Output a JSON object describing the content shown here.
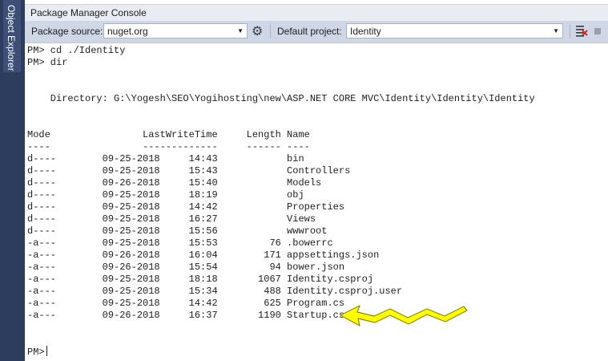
{
  "side": {
    "tab_label": "Object Explorer"
  },
  "window": {
    "title": "Package Manager Console"
  },
  "toolbar": {
    "package_source_label": "Package source:",
    "package_source_value": "nuget.org",
    "default_project_label": "Default project:",
    "default_project_value": "Identity"
  },
  "console": {
    "cmd1": "PM> cd ./Identity",
    "cmd2": "PM> dir",
    "directory_line": "    Directory: G:\\Yogesh\\SEO\\Yogihosting\\new\\ASP.NET CORE MVC\\Identity\\Identity\\Identity",
    "header": "Mode                LastWriteTime     Length Name",
    "underline": "----                -------------     ------ ----",
    "rows": [
      "d----        09-25-2018     14:43            bin",
      "d----        09-25-2018     15:43            Controllers",
      "d----        09-26-2018     15:40            Models",
      "d----        09-25-2018     18:19            obj",
      "d----        09-25-2018     14:42            Properties",
      "d----        09-25-2018     16:27            Views",
      "d----        09-25-2018     15:56            wwwroot",
      "-a---        09-25-2018     15:53         76 .bowerrc",
      "-a---        09-26-2018     16:04        171 appsettings.json",
      "-a---        09-26-2018     15:54         94 bower.json",
      "-a---        09-25-2018     18:18       1067 Identity.csproj",
      "-a---        09-25-2018     15:34        488 Identity.csproj.user",
      "-a---        09-25-2018     14:42        625 Program.cs",
      "-a---        09-26-2018     16:37       1190 Startup.cs"
    ],
    "prompt": "PM>"
  },
  "colors": {
    "arrow_fill": "#ffff00",
    "side_strip": "#2d3d5e",
    "toolbar_bg": "#cfd6e5"
  },
  "icons": [
    "gear-icon",
    "clear-console-icon",
    "stop-icon",
    "dropdown-arrow-icon"
  ]
}
